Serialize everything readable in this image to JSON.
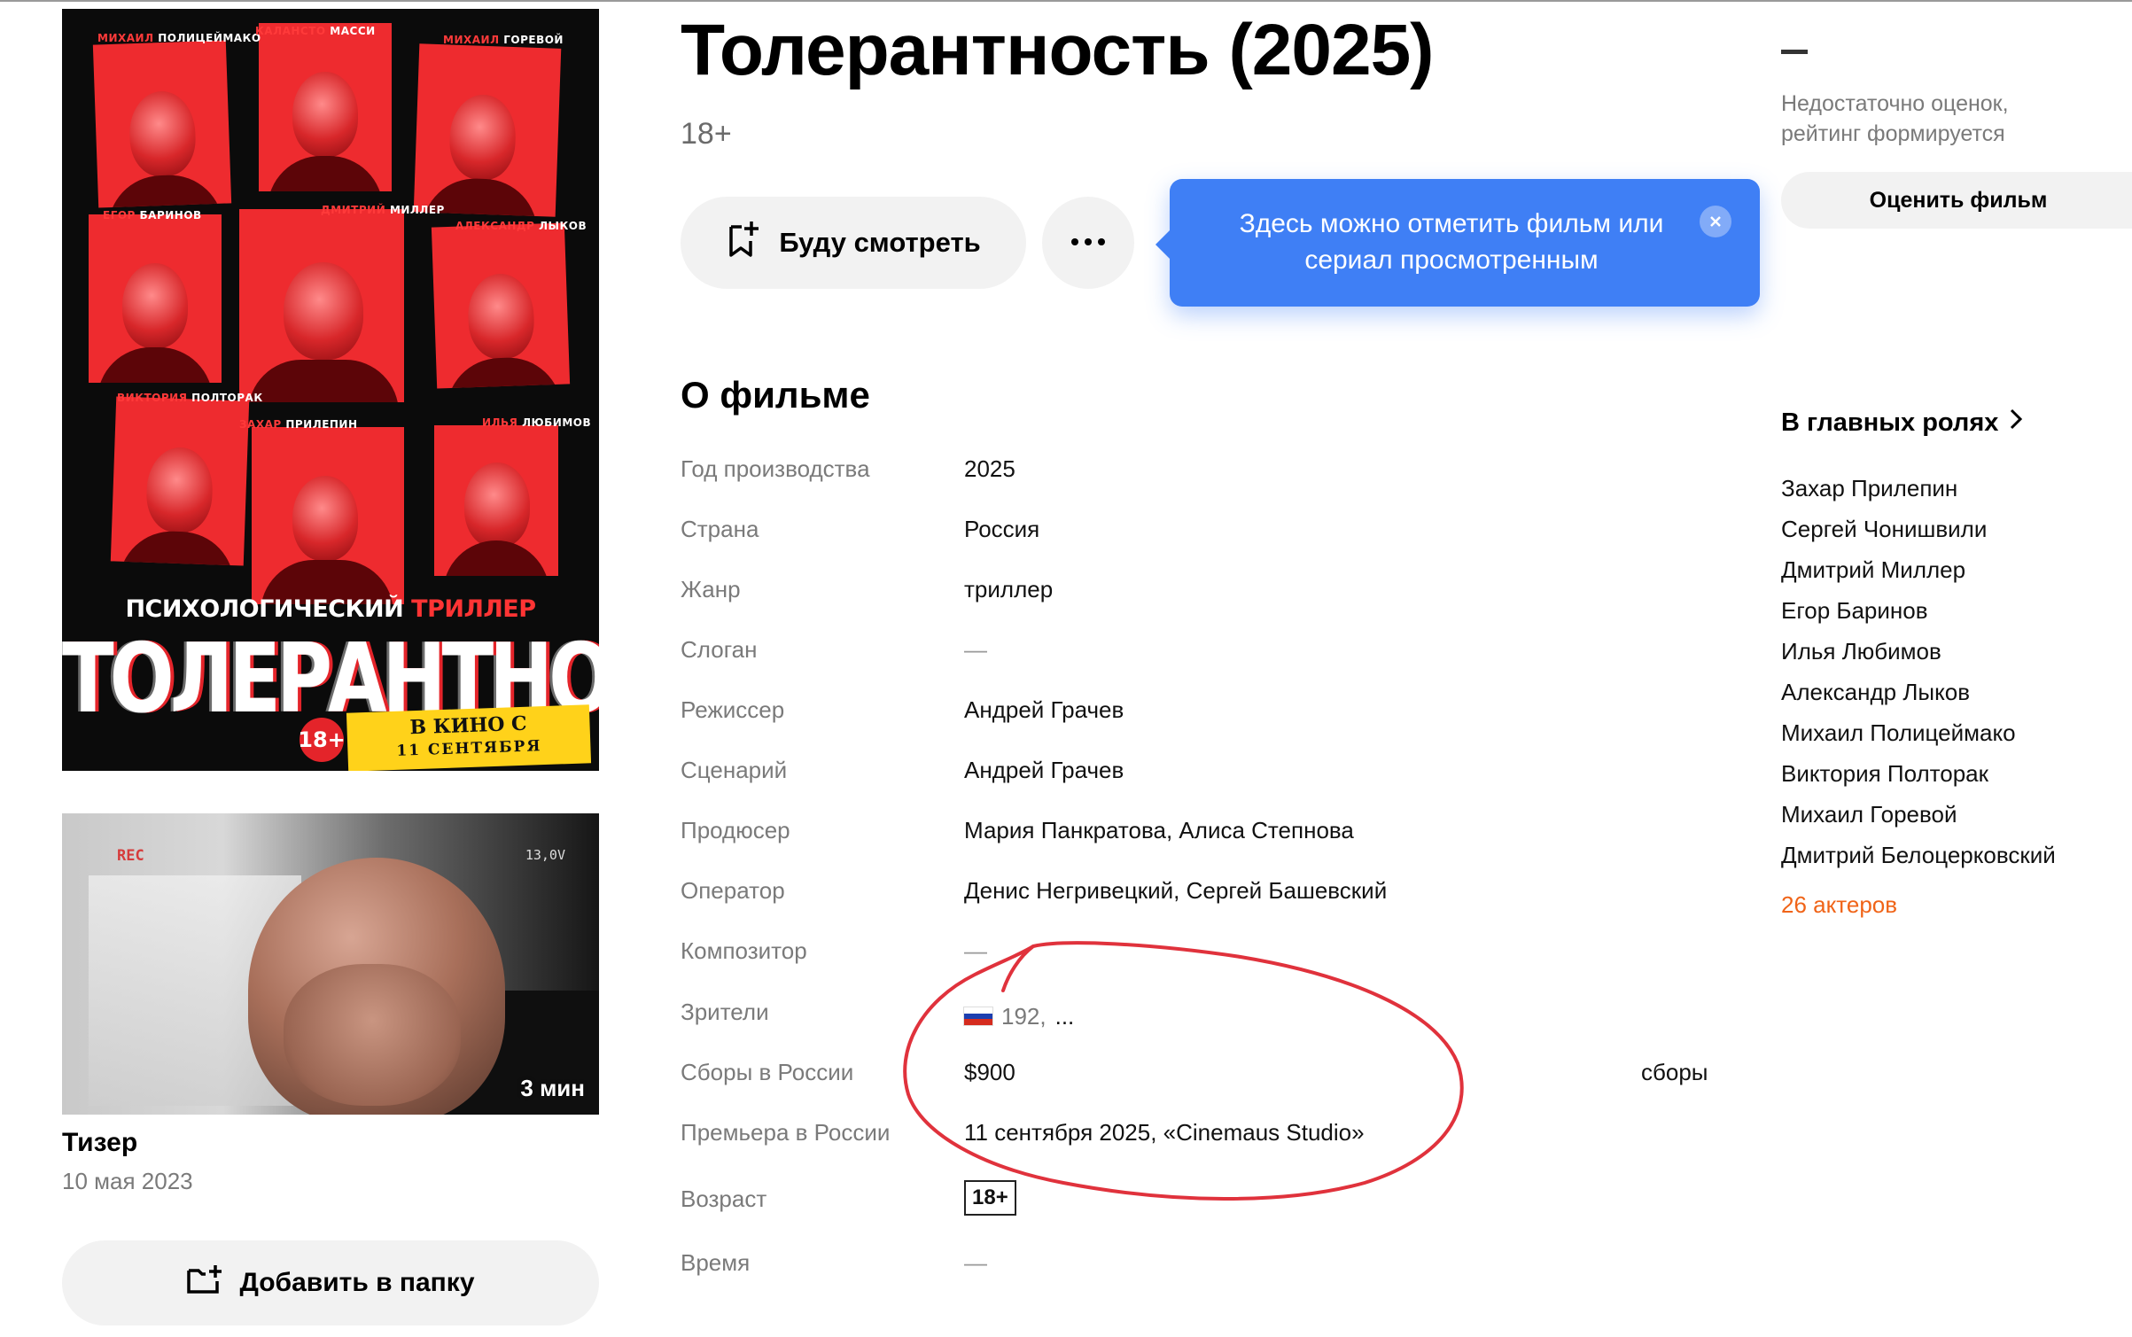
{
  "poster": {
    "cast_names": [
      {
        "first": "МИХАИЛ",
        "last": "ПОЛИЦЕЙМАКО"
      },
      {
        "first": "КАЛАНСТО",
        "last": "МАССИ"
      },
      {
        "first": "МИХАИЛ",
        "last": "ГОРЕВОЙ"
      },
      {
        "first": "ЕГОР",
        "last": "БАРИНОВ"
      },
      {
        "first": "ДМИТРИЙ",
        "last": "МИЛЛЕР"
      },
      {
        "first": "АЛЕКСАНДР",
        "last": "ЛЫКОВ"
      },
      {
        "first": "ВИКТОРИЯ",
        "last": "ПОЛТОРАК"
      },
      {
        "first": "ЗАХАР",
        "last": "ПРИЛЕПИН"
      },
      {
        "first": "ИЛЬЯ",
        "last": "ЛЮБИМОВ"
      }
    ],
    "genre_white": "ПСИХОЛОГИЧЕСКИЙ",
    "genre_red": "ТРИЛЛЕР",
    "title": "ТОЛЕРАНТНОСТЬ",
    "age": "18+",
    "release_line1": "В КИНО С",
    "release_line2": "11 СЕНТЯБРЯ"
  },
  "video": {
    "overlay_rec": "REC",
    "overlay_voltage": "13,0V",
    "duration": "3 мин",
    "title": "Тизер",
    "date": "10 мая 2023"
  },
  "folder_button": {
    "label": "Добавить в папку",
    "icon": "add-folder-icon"
  },
  "film": {
    "title": "Толерантность (2025)",
    "age_rating": "18+"
  },
  "actions": {
    "watch_later_label": "Буду смотреть",
    "watch_later_icon": "bookmark-plus-icon",
    "more_icon": "more-dots-icon"
  },
  "tooltip": {
    "text": "Здесь можно отметить фильм или сериал просмотренным",
    "close_icon": "close-icon",
    "color": "#3f7ff5"
  },
  "about": {
    "heading": "О фильме",
    "rows": [
      {
        "label": "Год производства",
        "value": "2025"
      },
      {
        "label": "Страна",
        "value": "Россия"
      },
      {
        "label": "Жанр",
        "value": "триллер"
      },
      {
        "label": "Слоган",
        "value": "—"
      },
      {
        "label": "Режиссер",
        "value": "Андрей Грачев"
      },
      {
        "label": "Сценарий",
        "value": "Андрей Грачев"
      },
      {
        "label": "Продюсер",
        "value": "Мария Панкратова, Алиса Степнова"
      },
      {
        "label": "Оператор",
        "value": "Денис Негривецкий, Сергей Башевский"
      },
      {
        "label": "Композитор",
        "value": "—"
      },
      {
        "label": "Зрители",
        "value": "192,",
        "more": "..."
      },
      {
        "label": "Сборы в России",
        "value": "$900",
        "link": "сборы"
      },
      {
        "label": "Премьера в России",
        "value": "11 сентября 2025, «Cinemaus Studio»"
      },
      {
        "label": "Возраст",
        "value": "18+"
      },
      {
        "label": "Время",
        "value": "—"
      }
    ]
  },
  "rating": {
    "value": "–",
    "note_line1": "Недостаточно оценок,",
    "note_line2": "рейтинг формируется",
    "rate_button": "Оценить фильм"
  },
  "cast": {
    "heading": "В главных ролях",
    "actors": [
      "Захар Прилепин",
      "Сергей Чонишвили",
      "Дмитрий Миллер",
      "Егор Баринов",
      "Илья Любимов",
      "Александр Лыков",
      "Михаил Полицеймако",
      "Виктория Полторак",
      "Михаил Горевой",
      "Дмитрий Белоцерковский"
    ],
    "count_link": "26 актеров",
    "count_color": "#f06418"
  },
  "annotation_color": "#e0323c"
}
